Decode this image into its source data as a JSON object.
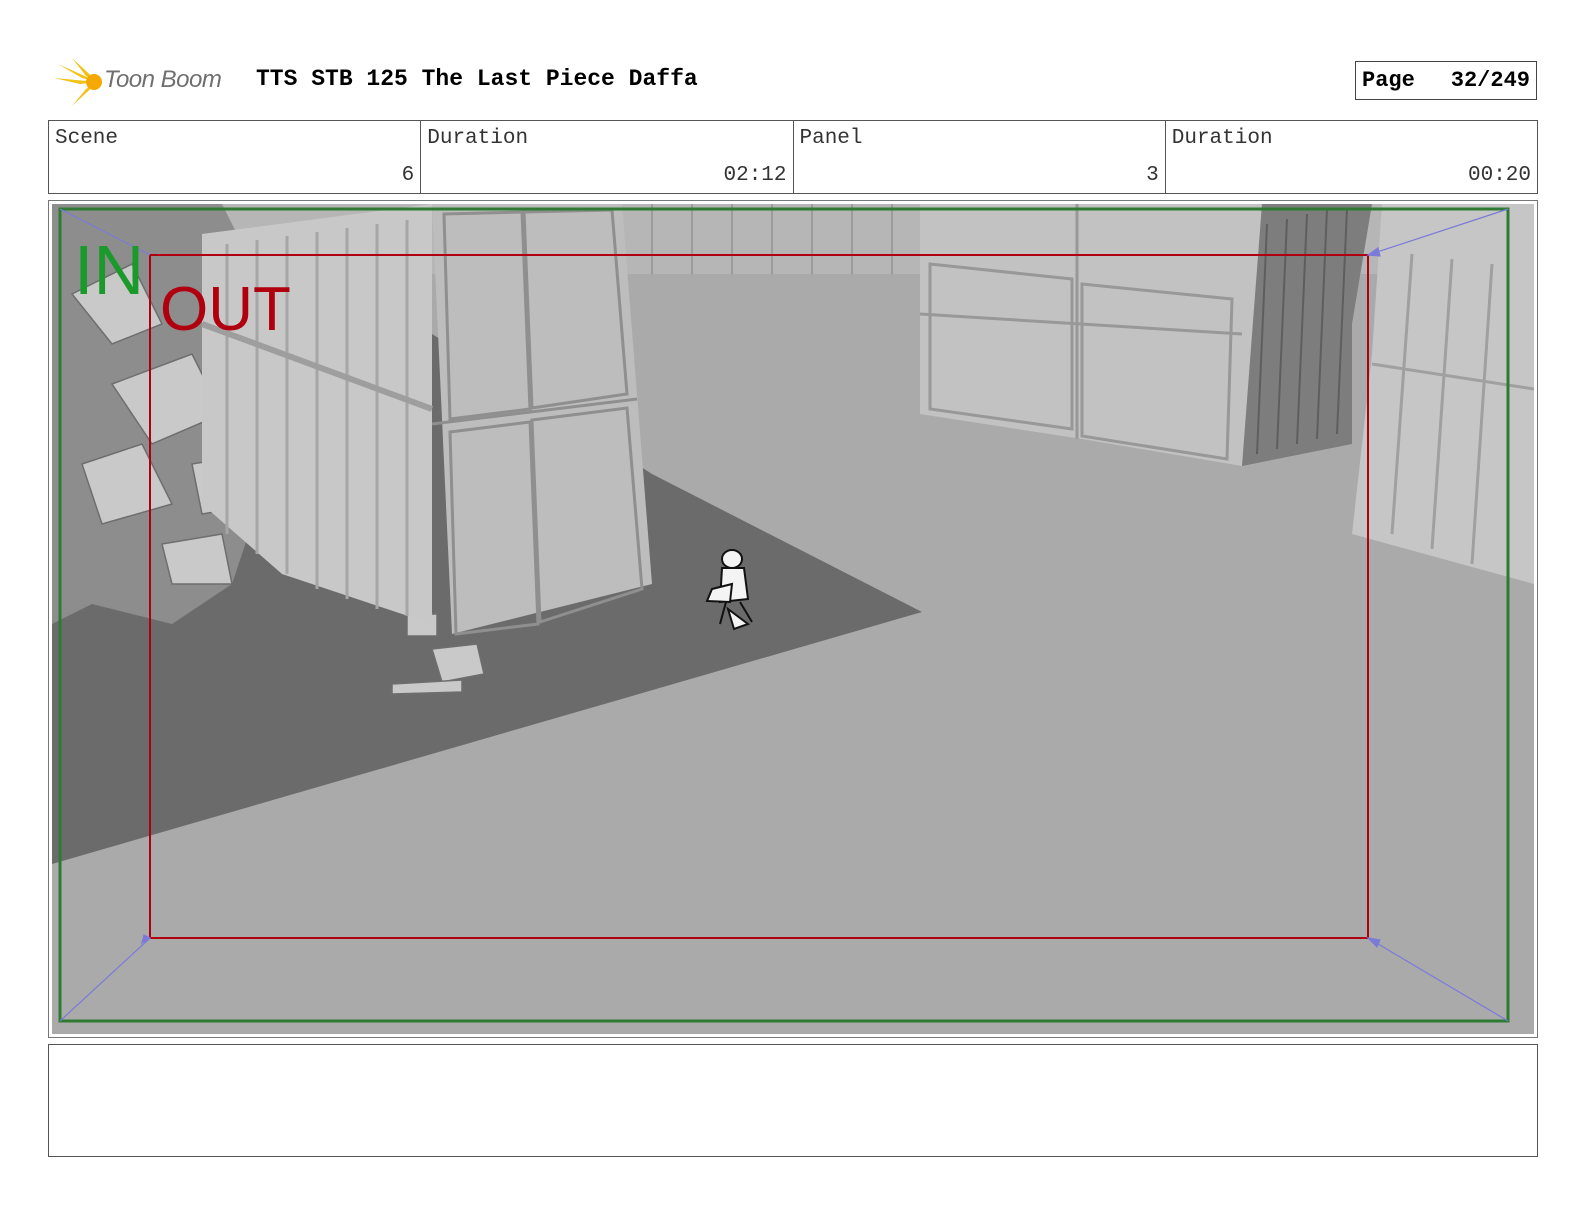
{
  "header": {
    "logo_text": "Toon Boom",
    "title": "TTS STB 125 The Last Piece Daffa",
    "page_label": "Page",
    "page_number": "32/249"
  },
  "info": {
    "scene_label": "Scene",
    "scene_value": "6",
    "scene_duration_label": "Duration",
    "scene_duration_value": "02:12",
    "panel_label": "Panel",
    "panel_value": "3",
    "panel_duration_label": "Duration",
    "panel_duration_value": "00:20"
  },
  "frame": {
    "in_label": "IN",
    "out_label": "OUT",
    "in_color": "#1a9a2a",
    "out_color": "#b00010",
    "camera_path_color": "#7a7ad8"
  },
  "notes": {
    "text": ""
  }
}
